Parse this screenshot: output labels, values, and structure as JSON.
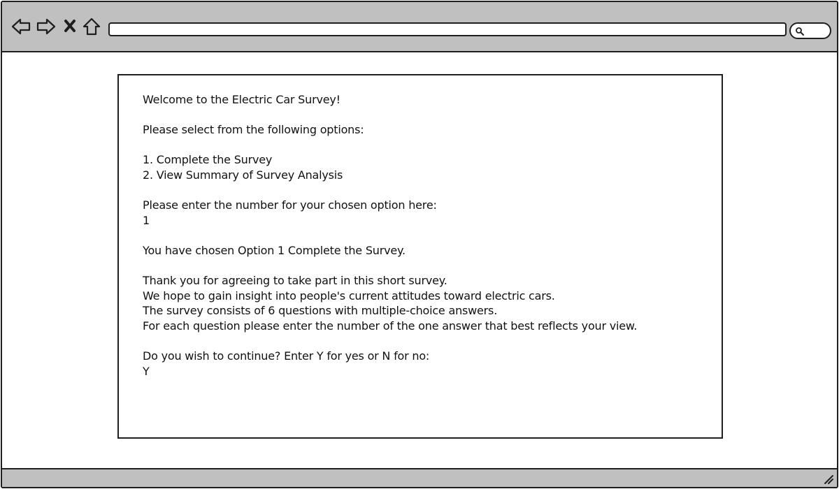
{
  "browser": {
    "address_value": "",
    "icons": [
      "back-arrow-icon",
      "forward-arrow-icon",
      "close-icon",
      "home-icon",
      "search-icon",
      "resize-grip-icon"
    ]
  },
  "console": {
    "welcome": "Welcome to the Electric Car Survey!",
    "select_prompt": "Please select from the following options:",
    "option_1": "1. Complete the Survey",
    "option_2": "2. View Summary of Survey Analysis",
    "enter_prompt": "Please enter the number for your chosen option here:",
    "option_input": "1",
    "chosen_message": "You have chosen Option 1 Complete the Survey.",
    "thanks_line": "Thank you for agreeing to take part in this short survey.",
    "insight_line": "We hope to gain insight into people's current attitudes toward electric cars.",
    "consists_line": "The survey consists of 6 questions with multiple-choice answers.",
    "instruction_line": "For each question please enter the number of the one answer that best reflects your view.",
    "continue_prompt": "Do you wish to continue? Enter Y for yes or N for no:",
    "continue_input": "Y"
  },
  "colors": {
    "chrome": "#c0c0c0",
    "stroke": "#1e1e1e",
    "text": "#111111"
  }
}
